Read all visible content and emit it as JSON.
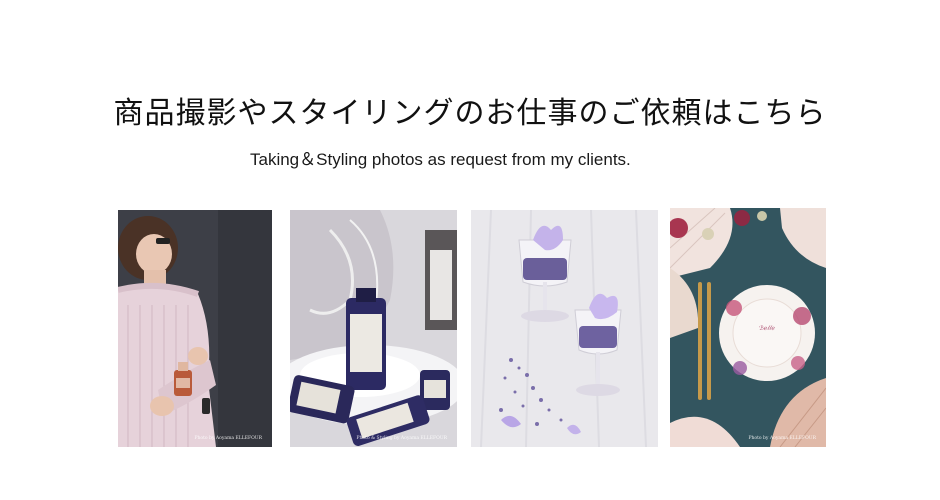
{
  "header": {
    "title_jp": "商品撮影やスタイリングのお仕事のご依頼はこちら",
    "subtitle_en": "Taking＆Styling photos as request from my clients."
  },
  "photos": [
    {
      "subject": "portrait of woman in pink knit sweater holding perfume bottle",
      "credit": "Photo by Aoyama ELLEFOUR"
    },
    {
      "subject": "lavender toiletry bottles on white fur with lace backdrop",
      "credit": "Photo & Styling by Aoyama ELLEFOUR"
    },
    {
      "subject": "lavender jelly dessert glasses with violet flowers on white wood",
      "credit": ""
    },
    {
      "subject": "floral plate with gold cutlery and paper fans on teal background",
      "credit": "Photo by Aoyama ELLEFOUR"
    }
  ],
  "colors": {
    "background": "#ffffff",
    "text": "#111111",
    "lavender": "#8a7fc0",
    "teal": "#33555f"
  }
}
